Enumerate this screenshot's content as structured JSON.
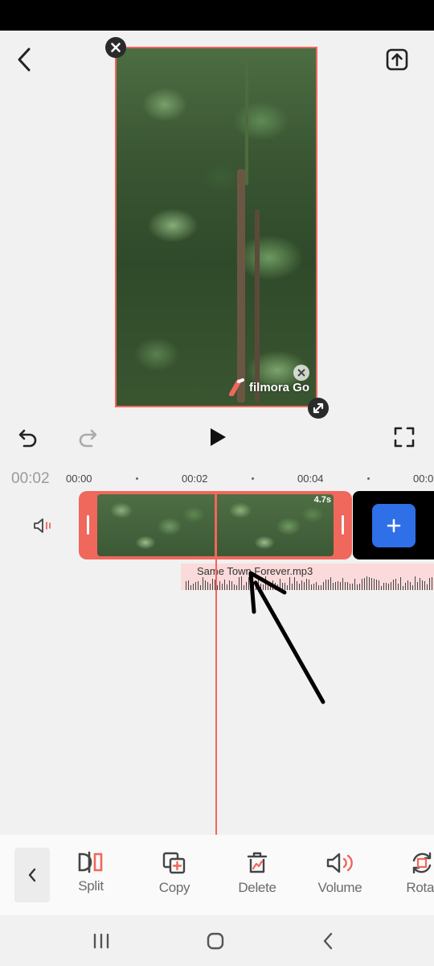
{
  "status_bar": {},
  "preview": {
    "watermark": "filmora Go"
  },
  "playback": {
    "current_time": "00:02"
  },
  "ruler": {
    "ticks": [
      "00:00",
      "00:02",
      "00:04",
      "00:0"
    ]
  },
  "clip": {
    "duration": "4.7s"
  },
  "audio": {
    "filename": "Same Town Forever.mp3"
  },
  "toolbar": {
    "items": [
      {
        "label": "Split",
        "icon": "split-icon"
      },
      {
        "label": "Copy",
        "icon": "copy-icon"
      },
      {
        "label": "Delete",
        "icon": "delete-icon"
      },
      {
        "label": "Volume",
        "icon": "volume-icon"
      },
      {
        "label": "Rotat",
        "icon": "rotate-icon"
      }
    ]
  },
  "colors": {
    "accent": "#f0675c",
    "add_button": "#2f6fe8"
  }
}
